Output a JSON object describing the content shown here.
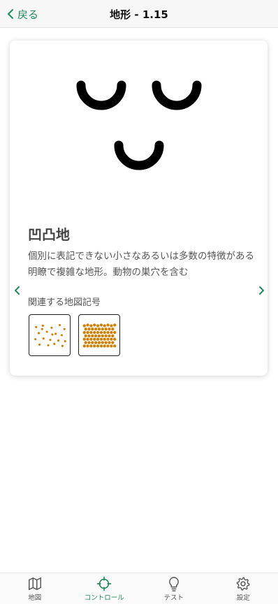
{
  "header": {
    "back_label": "戻る",
    "title": "地形 - 1.15"
  },
  "card": {
    "heading": "凹凸地",
    "description": "個別に表記できない小さなあるいは多数の特徴がある明瞭で複雑な地形。動物の巣穴を含む",
    "related_label": "関連する地図記号",
    "symbol_color": "#000000",
    "related_symbol_color": "#d17f00"
  },
  "tabbar": {
    "tabs": [
      {
        "label": "地図",
        "icon": "map-icon"
      },
      {
        "label": "コントロール",
        "icon": "crosshair-icon"
      },
      {
        "label": "テスト",
        "icon": "lightbulb-icon"
      },
      {
        "label": "設定",
        "icon": "gear-icon"
      }
    ],
    "active_color": "#1f8a5b"
  }
}
